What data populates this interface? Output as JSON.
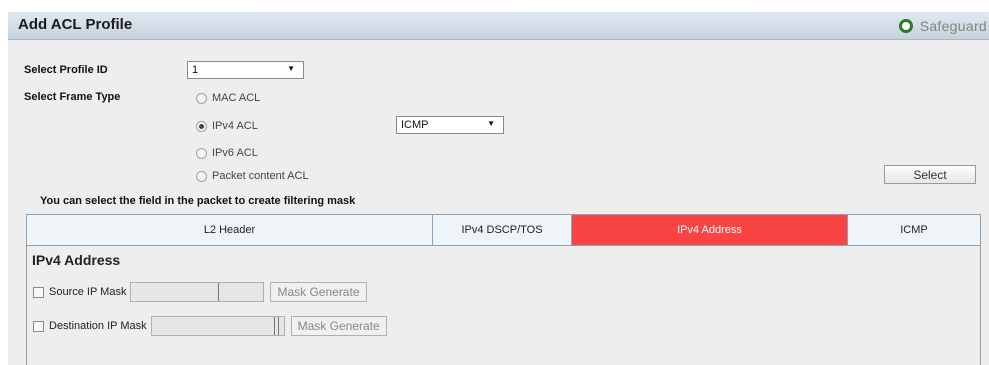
{
  "header": {
    "title": "Add ACL Profile",
    "safeguard_label": "Safeguard",
    "safeguard_color": "#2d7a2d"
  },
  "form": {
    "profile_id_label": "Select Profile ID",
    "profile_id_value": "1",
    "frame_type_label": "Select Frame Type",
    "frame_types": [
      "MAC ACL",
      "IPv4 ACL",
      "IPv6 ACL",
      "Packet content ACL"
    ],
    "selected_frame_type": "IPv4 ACL",
    "protocol_value": "ICMP",
    "select_button": "Select"
  },
  "hint": "You can select the field in the packet to create filtering mask",
  "tabs": [
    "L2 Header",
    "IPv4 DSCP/TOS",
    "IPv4 Address",
    "ICMP"
  ],
  "active_tab": "IPv4 Address",
  "active_tab_color": "#fa4444",
  "ipv4_section": {
    "title": "IPv4 Address",
    "source_label": "Source IP Mask",
    "dest_label": "Destination IP Mask",
    "mask_generate": "Mask Generate"
  }
}
